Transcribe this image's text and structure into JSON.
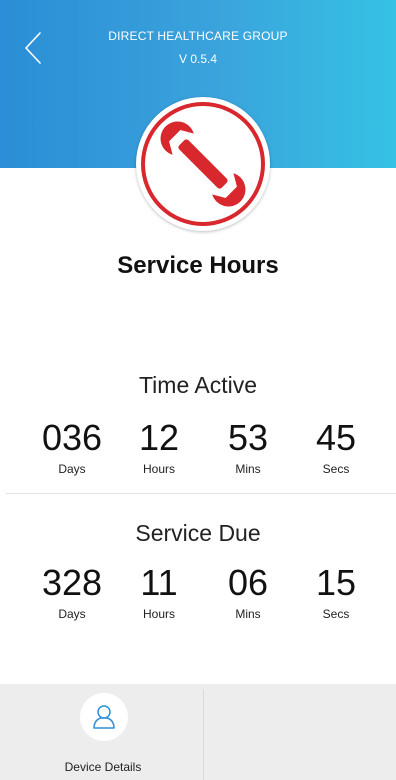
{
  "header": {
    "organization": "DIRECT HEALTHCARE GROUP",
    "version": "V 0.5.4",
    "gradient_start": "#2b8ed6",
    "gradient_end": "#35c2e4",
    "back_icon": "chevron-left-icon"
  },
  "badge": {
    "icon": "wrench-icon",
    "color": "#d9272e"
  },
  "page_title": "Service Hours",
  "time_active": {
    "title": "Time Active",
    "values": [
      {
        "value": "036",
        "unit": "Days"
      },
      {
        "value": "12",
        "unit": "Hours"
      },
      {
        "value": "53",
        "unit": "Mins"
      },
      {
        "value": "45",
        "unit": "Secs"
      }
    ]
  },
  "service_due": {
    "title": "Service Due",
    "values": [
      {
        "value": "328",
        "unit": "Days"
      },
      {
        "value": "11",
        "unit": "Hours"
      },
      {
        "value": "06",
        "unit": "Mins"
      },
      {
        "value": "15",
        "unit": "Secs"
      }
    ]
  },
  "bottom_nav": {
    "device_details": {
      "label": "Device Details",
      "icon": "user-icon",
      "icon_color": "#2e8fd8"
    }
  }
}
